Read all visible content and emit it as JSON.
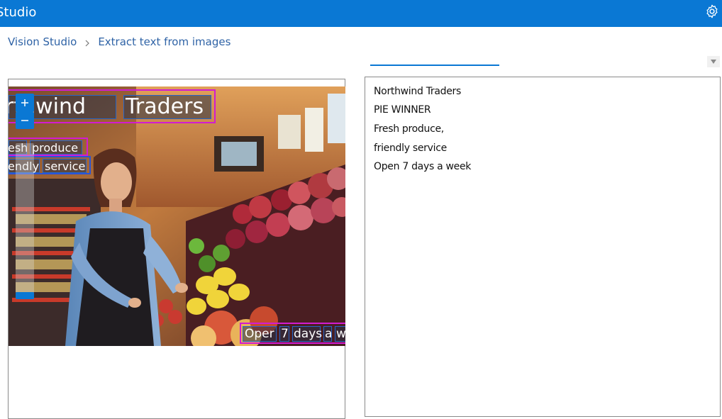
{
  "header": {
    "app_title": "Studio",
    "settings_icon": "gear-icon",
    "accent_color": "#0a78d4"
  },
  "breadcrumb": {
    "root": "Vision Studio",
    "separator_icon": "chevron-right-icon",
    "current": "Extract text from images"
  },
  "image_overlay": {
    "lines": [
      {
        "words": [
          "rthwind",
          "Traders"
        ]
      },
      {
        "words": [
          "esh",
          "produce"
        ]
      },
      {
        "words": [
          "endly",
          "service"
        ]
      },
      {
        "words": [
          "Oper",
          "7",
          "days",
          "a",
          "w"
        ]
      }
    ],
    "box_color": "#d21bd1",
    "word_box_color": "#2466c8"
  },
  "results": {
    "lines": [
      "Northwind Traders",
      "PIE WINNER",
      "Fresh produce,",
      "friendly service",
      "Open 7 days a week"
    ]
  }
}
